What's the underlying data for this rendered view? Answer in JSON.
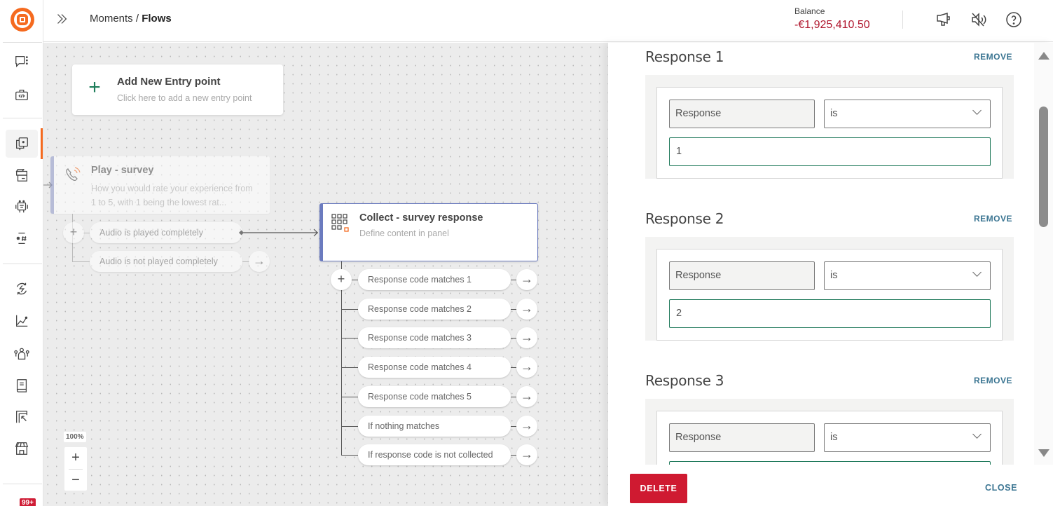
{
  "app": {
    "breadcrumb": {
      "parent": "Moments",
      "separator": " / ",
      "current": "Flows"
    },
    "balance": {
      "label": "Balance",
      "value": "-€1,925,410.50",
      "color": "#b0172e"
    },
    "accent_color": "#f56a1f"
  },
  "sidebar": {
    "items": [
      {
        "icon": "chat-options-icon",
        "label": "Conversations"
      },
      {
        "icon": "code-briefcase-icon",
        "label": "Developer"
      },
      {
        "icon": "moments-flows-icon",
        "label": "Moments",
        "active": true
      },
      {
        "icon": "templates-icon",
        "label": "Templates"
      },
      {
        "icon": "bot-icon",
        "label": "Bots"
      },
      {
        "icon": "hashtag-keywords-icon",
        "label": "Keywords"
      },
      {
        "icon": "integrations-icon",
        "label": "Integrations"
      },
      {
        "icon": "analytics-chart-icon",
        "label": "Analyze"
      },
      {
        "icon": "people-icon",
        "label": "People"
      },
      {
        "icon": "book-icon",
        "label": "Documentation"
      },
      {
        "icon": "exchange-icon",
        "label": "Exchange"
      },
      {
        "icon": "store-icon",
        "label": "Marketplace"
      }
    ],
    "notification_badge": "99+"
  },
  "canvas": {
    "entry_point": {
      "title": "Add New Entry point",
      "subtitle": "Click here to add a new entry point"
    },
    "play_node": {
      "title": "Play - survey",
      "subtitle": "How you would rate your experience from 1 to 5, with 1 being the lowest rat...",
      "branches": [
        "Audio is played completely",
        "Audio is not played completely"
      ]
    },
    "collect_node": {
      "title": "Collect - survey response",
      "subtitle": "Define content in panel",
      "branches": [
        "Response code matches 1",
        "Response code matches 2",
        "Response code matches 3",
        "Response code matches 4",
        "Response code matches 5",
        "If nothing matches",
        "If response code is not collected"
      ]
    },
    "zoom_level": "100%",
    "zoom_in": "+",
    "zoom_out": "−"
  },
  "panel": {
    "responses": [
      {
        "title": "Response 1",
        "remove_label": "REMOVE",
        "field": "Response",
        "operator": "is",
        "value": "1"
      },
      {
        "title": "Response 2",
        "remove_label": "REMOVE",
        "field": "Response",
        "operator": "is",
        "value": "2"
      },
      {
        "title": "Response 3",
        "remove_label": "REMOVE",
        "field": "Response",
        "operator": "is",
        "value": ""
      }
    ],
    "delete_label": "DELETE",
    "close_label": "CLOSE",
    "delete_color": "#cf1a31",
    "link_color": "#3b7592"
  }
}
